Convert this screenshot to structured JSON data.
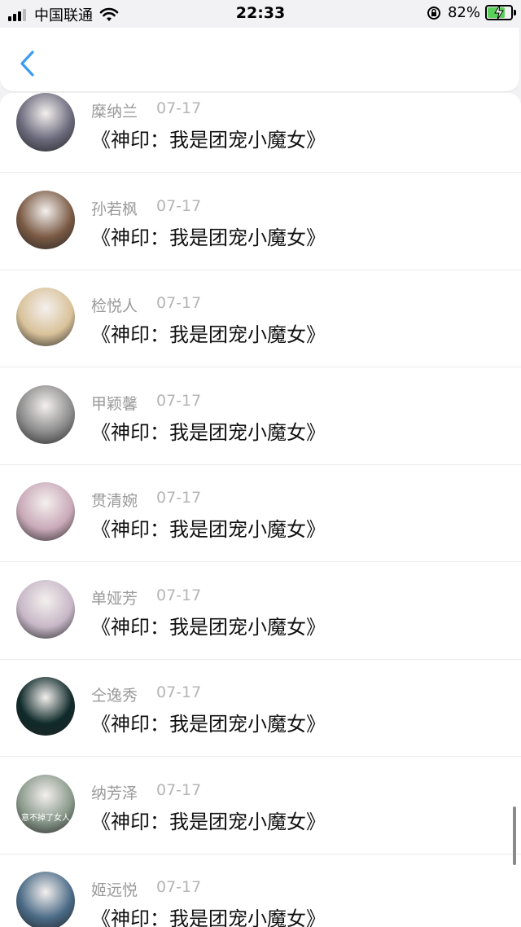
{
  "status_bar": {
    "carrier": "中国联通",
    "time": "22:33",
    "battery_percent": "82%",
    "battery_level": 0.82
  },
  "nav": {
    "back_icon": "chevron-left-icon"
  },
  "comments": [
    {
      "name": "糜纳兰",
      "date": "07-17",
      "book": "《神印：我是团宠小魔女》",
      "avatar_color": "#6b6a7c"
    },
    {
      "name": "孙若枫",
      "date": "07-17",
      "book": "《神印：我是团宠小魔女》",
      "avatar_color": "#7a5a44"
    },
    {
      "name": "检悦人",
      "date": "07-17",
      "book": "《神印：我是团宠小魔女》",
      "avatar_color": "#d9c29a"
    },
    {
      "name": "甲颖馨",
      "date": "07-17",
      "book": "《神印：我是团宠小魔女》",
      "avatar_color": "#8c8c8c"
    },
    {
      "name": "贯清婉",
      "date": "07-17",
      "book": "《神印：我是团宠小魔女》",
      "avatar_color": "#c9a9b8"
    },
    {
      "name": "单娅芳",
      "date": "07-17",
      "book": "《神印：我是团宠小魔女》",
      "avatar_color": "#c7b7c7"
    },
    {
      "name": "仝逸秀",
      "date": "07-17",
      "book": "《神印：我是团宠小魔女》",
      "avatar_color": "#0f2a2a"
    },
    {
      "name": "纳芳泽",
      "date": "07-17",
      "book": "《神印：我是团宠小魔女》",
      "avatar_color": "#8a9a8c",
      "avatar_caption": "意不掉了女人"
    },
    {
      "name": "姬远悦",
      "date": "07-17",
      "book": "《神印：我是团宠小魔女》",
      "avatar_color": "#4a6a86"
    }
  ]
}
